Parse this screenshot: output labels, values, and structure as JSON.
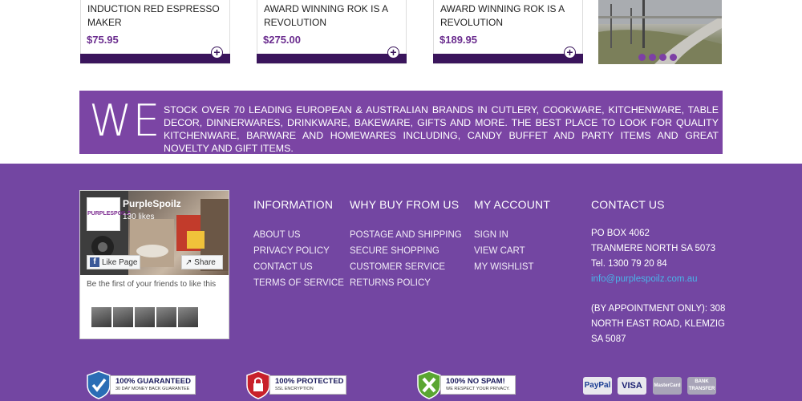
{
  "products": [
    {
      "name": "INDUCTION RED ESPRESSO MAKER",
      "price": "$75.95"
    },
    {
      "name": "AWARD WINNING ROK IS A REVOLUTION",
      "price": "$275.00"
    },
    {
      "name": "AWARD WINNING ROK IS A REVOLUTION",
      "price": "$189.95"
    }
  ],
  "add_icon": "+",
  "banner": {
    "big": "WE",
    "text": "STOCK OVER 70 LEADING EUROPEAN & AUSTRALIAN BRANDS IN CUTLERY, COOKWARE, KITCHENWARE, TABLE DECOR, DINNERWARES, DRINKWARE, BAKEWARE, GIFTS AND MORE. THE BEST PLACE TO LOOK FOR QUALITY KITCHENWARE, BARWARE AND HOMEWARES INCLUDING, CANDY BUFFET AND PARTY ITEMS AND GREAT NOVELTY AND GIFT ITEMS."
  },
  "facebook": {
    "logo_text": "PURPLESPOILZ",
    "page_name": "PurpleSpoilz",
    "likes": "130 likes",
    "like_label": "Like Page",
    "share_label": "Share",
    "friends_text": "Be the first of your friends to like this",
    "like_icon": "f",
    "share_icon": "↗"
  },
  "information": {
    "title": "INFORMATION",
    "links": [
      "ABOUT US",
      "PRIVACY POLICY",
      "CONTACT US",
      "TERMS OF SERVICE"
    ]
  },
  "why_buy": {
    "title": "WHY BUY FROM US",
    "links": [
      "POSTAGE AND SHIPPING",
      "SECURE SHOPPING",
      "CUSTOMER SERVICE",
      "RETURNS POLICY"
    ]
  },
  "my_account": {
    "title": "MY ACCOUNT",
    "links": [
      "SIGN IN",
      "VIEW CART",
      "MY WISHLIST"
    ]
  },
  "contact": {
    "title": "CONTACT US",
    "po_box": "PO BOX 4062",
    "suburb": "TRANMERE NORTH SA 5073",
    "tel": "Tel. 1300 79 20 84",
    "email": "info@purplespoilz.com.au",
    "appt_1": "(BY APPOINTMENT ONLY): 308",
    "appt_2": "NORTH EAST ROAD, KLEMZIG",
    "appt_3": "SA 5087"
  },
  "badges": [
    {
      "line1": "100% GUARANTEED",
      "line2": "30 DAY MONEY BACK GUARANTEE",
      "icon": "checkmark-shield-icon"
    },
    {
      "line1": "100% PROTECTED",
      "line2": "SSL ENCRYPTION",
      "icon": "lock-shield-icon"
    },
    {
      "line1": "100% NO SPAM!",
      "line2": "WE RESPECT YOUR PRIVACY.",
      "icon": "no-spam-shield-icon"
    }
  ],
  "payments": {
    "paypal": "PayPal",
    "visa": "VISA",
    "mastercard": "MasterCard",
    "bank": "BANK TRANSFER"
  },
  "colors": {
    "purple_dark": "#3a155c",
    "purple_banner": "#7b45a4",
    "purple_footer": "#7346a2",
    "email_link": "#4ab3e8"
  }
}
